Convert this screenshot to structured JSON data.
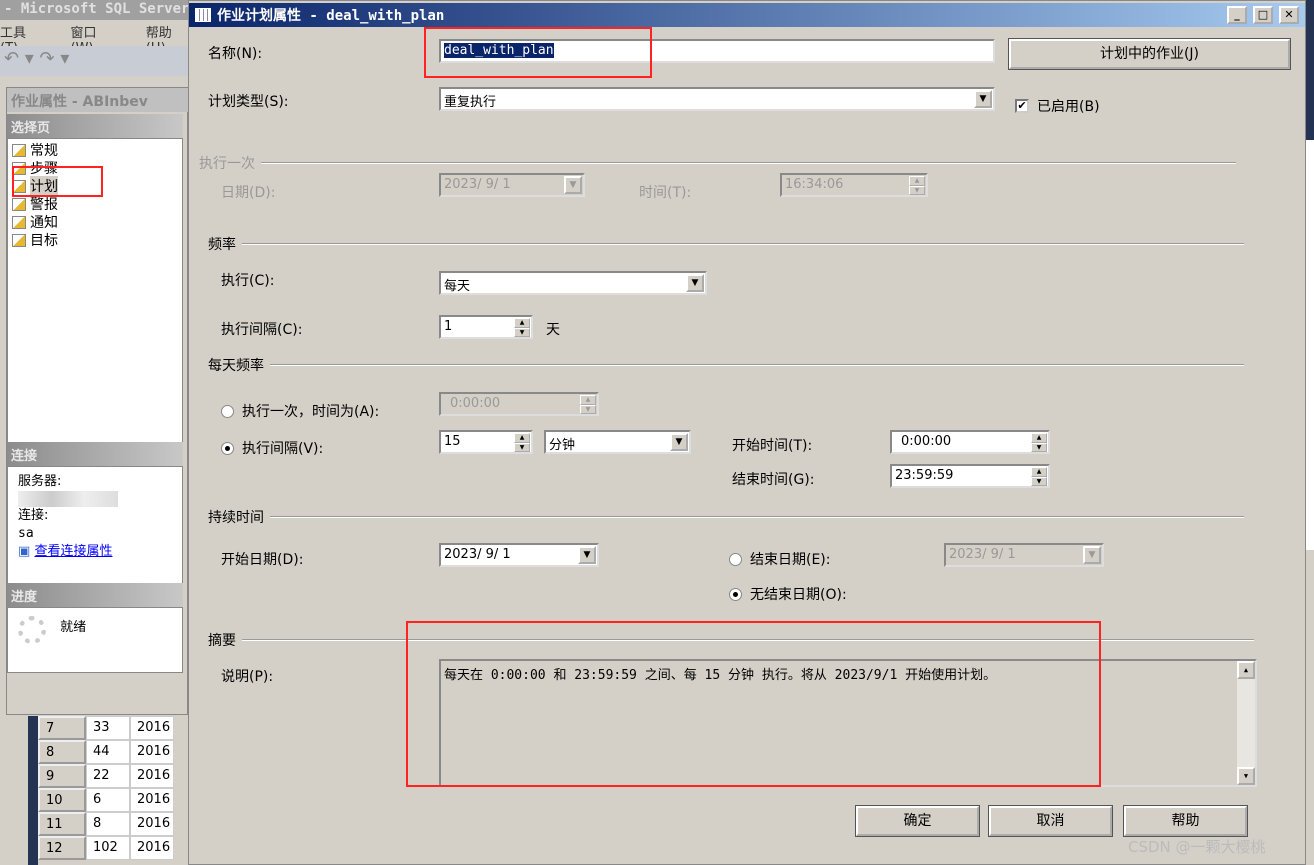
{
  "background": {
    "app_title": "- Microsoft SQL Server",
    "menu": [
      "工具(T)",
      "窗口(W)",
      "帮助(H)"
    ],
    "job_window": {
      "title": "作业属性 - ABInbev",
      "select_page": "选择页",
      "pages": [
        "常规",
        "步骤",
        "计划",
        "警报",
        "通知",
        "目标"
      ],
      "selected_page": "计划",
      "connection_header": "连接",
      "server_label": "服务器:",
      "connection_label": "连接:",
      "connection_value": "sa",
      "view_connection_link": "查看连接属性",
      "progress_header": "进度",
      "progress_status": "就绪"
    },
    "grid_rows": [
      [
        "7",
        "33",
        "2016"
      ],
      [
        "8",
        "44",
        "2016"
      ],
      [
        "9",
        "22",
        "2016"
      ],
      [
        "10",
        "6",
        "2016"
      ],
      [
        "11",
        "8",
        "2016"
      ],
      [
        "12",
        "102",
        "2016"
      ]
    ]
  },
  "dialog": {
    "title": "作业计划属性 - deal_with_plan",
    "name_label": "名称(N):",
    "name_value": "deal_with_plan",
    "jobs_in_schedule_button": "计划中的作业(J)",
    "schedule_type_label": "计划类型(S):",
    "schedule_type_value": "重复执行",
    "enabled_label": "已启用(B)",
    "enabled": true,
    "one_time": {
      "header": "执行一次",
      "date_label": "日期(D):",
      "date_value": "2023/ 9/ 1",
      "time_label": "时间(T):",
      "time_value": "16:34:06"
    },
    "frequency": {
      "header": "频率",
      "occurs_label": "执行(C):",
      "occurs_value": "每天",
      "recurs_label": "执行间隔(C):",
      "recurs_value": "1",
      "recurs_unit": "天"
    },
    "daily_frequency": {
      "header": "每天频率",
      "once_label": "执行一次，时间为(A):",
      "once_value": "0:00:00",
      "every_label": "执行间隔(V):",
      "every_value": "15",
      "every_unit": "分钟",
      "selected": "every",
      "start_time_label": "开始时间(T):",
      "start_time_value": "0:00:00",
      "end_time_label": "结束时间(G):",
      "end_time_value": "23:59:59"
    },
    "duration": {
      "header": "持续时间",
      "start_date_label": "开始日期(D):",
      "start_date_value": "2023/ 9/ 1",
      "end_date_label": "结束日期(E):",
      "end_date_value": "2023/ 9/ 1",
      "no_end_label": "无结束日期(O):",
      "selected": "no_end"
    },
    "summary": {
      "header": "摘要",
      "description_label": "说明(P):",
      "description_value": "每天在 0:00:00 和 23:59:59 之间、每 15 分钟 执行。将从 2023/9/1 开始使用计划。"
    },
    "buttons": {
      "ok": "确定",
      "cancel": "取消",
      "help": "帮助"
    }
  },
  "watermark": "CSDN @一颗大樱桃"
}
